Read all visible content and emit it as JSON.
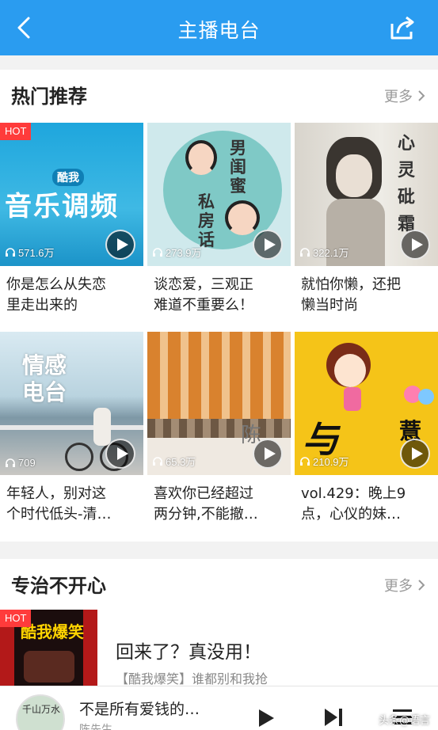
{
  "header": {
    "title": "主播电台",
    "back_icon": "back-chevron-icon",
    "share_icon": "share-icon"
  },
  "hot_section": {
    "title": "热门推荐",
    "more_label": "更多",
    "cards": [
      {
        "title": "你是怎么从失恋\n里走出来的",
        "plays": "571.6万",
        "hot": "HOT",
        "art_text_1": "酷我",
        "art_text_2": "音乐调频"
      },
      {
        "title": "谈恋爱，三观正\n难道不重要么！",
        "plays": "273.9万",
        "art_text_1": "男闺蜜",
        "art_text_2": "私房话"
      },
      {
        "title": "就怕你懒，还把\n懒当时尚",
        "plays": "322.1万",
        "art_text_1": "心灵砒霜"
      },
      {
        "title": "年轻人，别对这\n个时代低头-清…",
        "plays": "709",
        "art_text_1": "情感",
        "art_text_2": "电台"
      },
      {
        "title": "喜欢你已经超过\n两分钟,不能撤…",
        "plays": "65.3万",
        "art_text_1": "陈"
      },
      {
        "title": "vol.429：晚上9\n点，心仪的妹…",
        "plays": "210.9万",
        "art_text_1": "与",
        "art_text_2": "薏"
      }
    ]
  },
  "second_section": {
    "title": "专治不开心",
    "more_label": "更多",
    "item": {
      "hot": "HOT",
      "art_text": "酷我爆笑",
      "title": "回来了？真没用！",
      "subtitle": "【酷我爆笑】谁都别和我抢"
    }
  },
  "player": {
    "title": "不是所有爱钱的…",
    "subtitle": "陈先生",
    "avatar_text": "千山万水"
  },
  "watermark": "头条@语言",
  "colors": {
    "brand": "#2a9cf0",
    "hot": "#ff3b3b"
  }
}
